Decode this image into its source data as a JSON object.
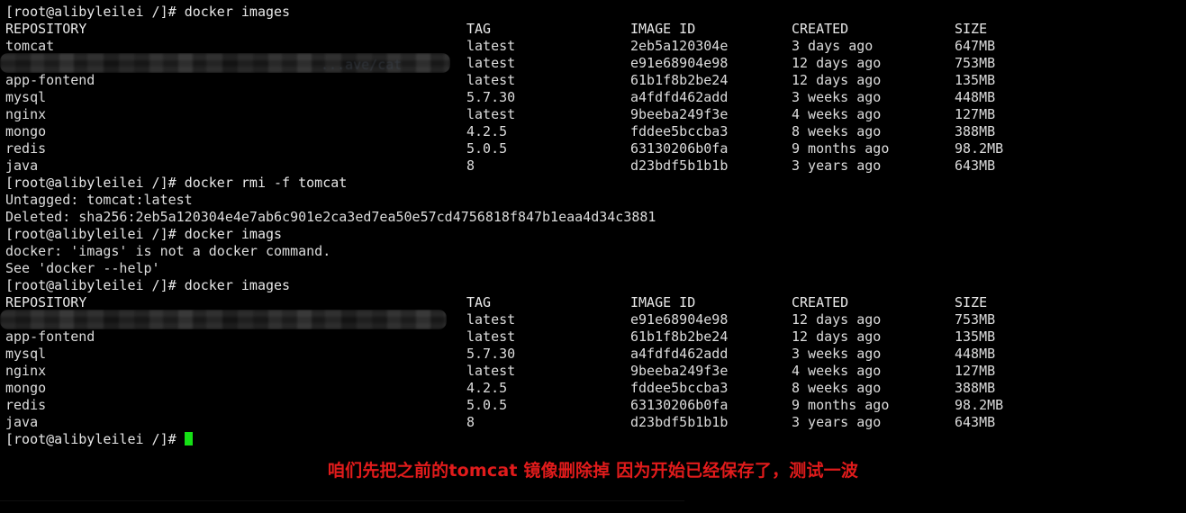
{
  "terminal": {
    "prompt": "[root@alibyleilei /]# ",
    "colors": {
      "background": "#000000",
      "foreground": "#e0e0e0",
      "cursor": "#15e015",
      "caption": "#e01b1b"
    },
    "table_headers": {
      "repository": "REPOSITORY",
      "tag": "TAG",
      "image_id": "IMAGE ID",
      "created": "CREATED",
      "size": "SIZE"
    },
    "commands": {
      "images_1": "docker images",
      "rmi": "docker rmi -f tomcat",
      "imags_typo": "docker imags",
      "images_2": "docker images"
    },
    "rmi_output": {
      "untagged": "Untagged: tomcat:latest",
      "deleted": "Deleted: sha256:2eb5a120304e4e7ab6c901e2ca3ed7ea50e57cd4756818f847b1eaa4d34c3881"
    },
    "error_output": {
      "not_a_command": "docker: 'imags' is not a docker command.",
      "see_help": "See 'docker --help'"
    },
    "images_before": [
      {
        "repository": "tomcat",
        "tag": "latest",
        "image_id": "2eb5a120304e",
        "created": "3 days ago",
        "size": "647MB",
        "redacted": false
      },
      {
        "repository": "",
        "tag": "latest",
        "image_id": "e91e68904e98",
        "created": "12 days ago",
        "size": "753MB",
        "redacted": true,
        "ghost": "...ave/cat"
      },
      {
        "repository": "app-fontend",
        "tag": "latest",
        "image_id": "61b1f8b2be24",
        "created": "12 days ago",
        "size": "135MB",
        "redacted": false
      },
      {
        "repository": "mysql",
        "tag": "5.7.30",
        "image_id": "a4fdfd462add",
        "created": "3 weeks ago",
        "size": "448MB",
        "redacted": false
      },
      {
        "repository": "nginx",
        "tag": "latest",
        "image_id": "9beeba249f3e",
        "created": "4 weeks ago",
        "size": "127MB",
        "redacted": false
      },
      {
        "repository": "mongo",
        "tag": "4.2.5",
        "image_id": "fddee5bccba3",
        "created": "8 weeks ago",
        "size": "388MB",
        "redacted": false
      },
      {
        "repository": "redis",
        "tag": "5.0.5",
        "image_id": "63130206b0fa",
        "created": "9 months ago",
        "size": "98.2MB",
        "redacted": false
      },
      {
        "repository": "java",
        "tag": "8",
        "image_id": "d23bdf5b1b1b",
        "created": "3 years ago",
        "size": "643MB",
        "redacted": false
      }
    ],
    "images_after": [
      {
        "repository": "",
        "tag": "latest",
        "image_id": "e91e68904e98",
        "created": "12 days ago",
        "size": "753MB",
        "redacted": true,
        "ghost": ""
      },
      {
        "repository": "app-fontend",
        "tag": "latest",
        "image_id": "61b1f8b2be24",
        "created": "12 days ago",
        "size": "135MB",
        "redacted": false
      },
      {
        "repository": "mysql",
        "tag": "5.7.30",
        "image_id": "a4fdfd462add",
        "created": "3 weeks ago",
        "size": "448MB",
        "redacted": false
      },
      {
        "repository": "nginx",
        "tag": "latest",
        "image_id": "9beeba249f3e",
        "created": "4 weeks ago",
        "size": "127MB",
        "redacted": false
      },
      {
        "repository": "mongo",
        "tag": "4.2.5",
        "image_id": "fddee5bccba3",
        "created": "8 weeks ago",
        "size": "388MB",
        "redacted": false
      },
      {
        "repository": "redis",
        "tag": "5.0.5",
        "image_id": "63130206b0fa",
        "created": "9 months ago",
        "size": "98.2MB",
        "redacted": false
      },
      {
        "repository": "java",
        "tag": "8",
        "image_id": "d23bdf5b1b1b",
        "created": "3 years ago",
        "size": "643MB",
        "redacted": false
      }
    ]
  },
  "caption": {
    "text": "咱们先把之前的tomcat 镜像删除掉 因为开始已经保存了，测试一波"
  }
}
